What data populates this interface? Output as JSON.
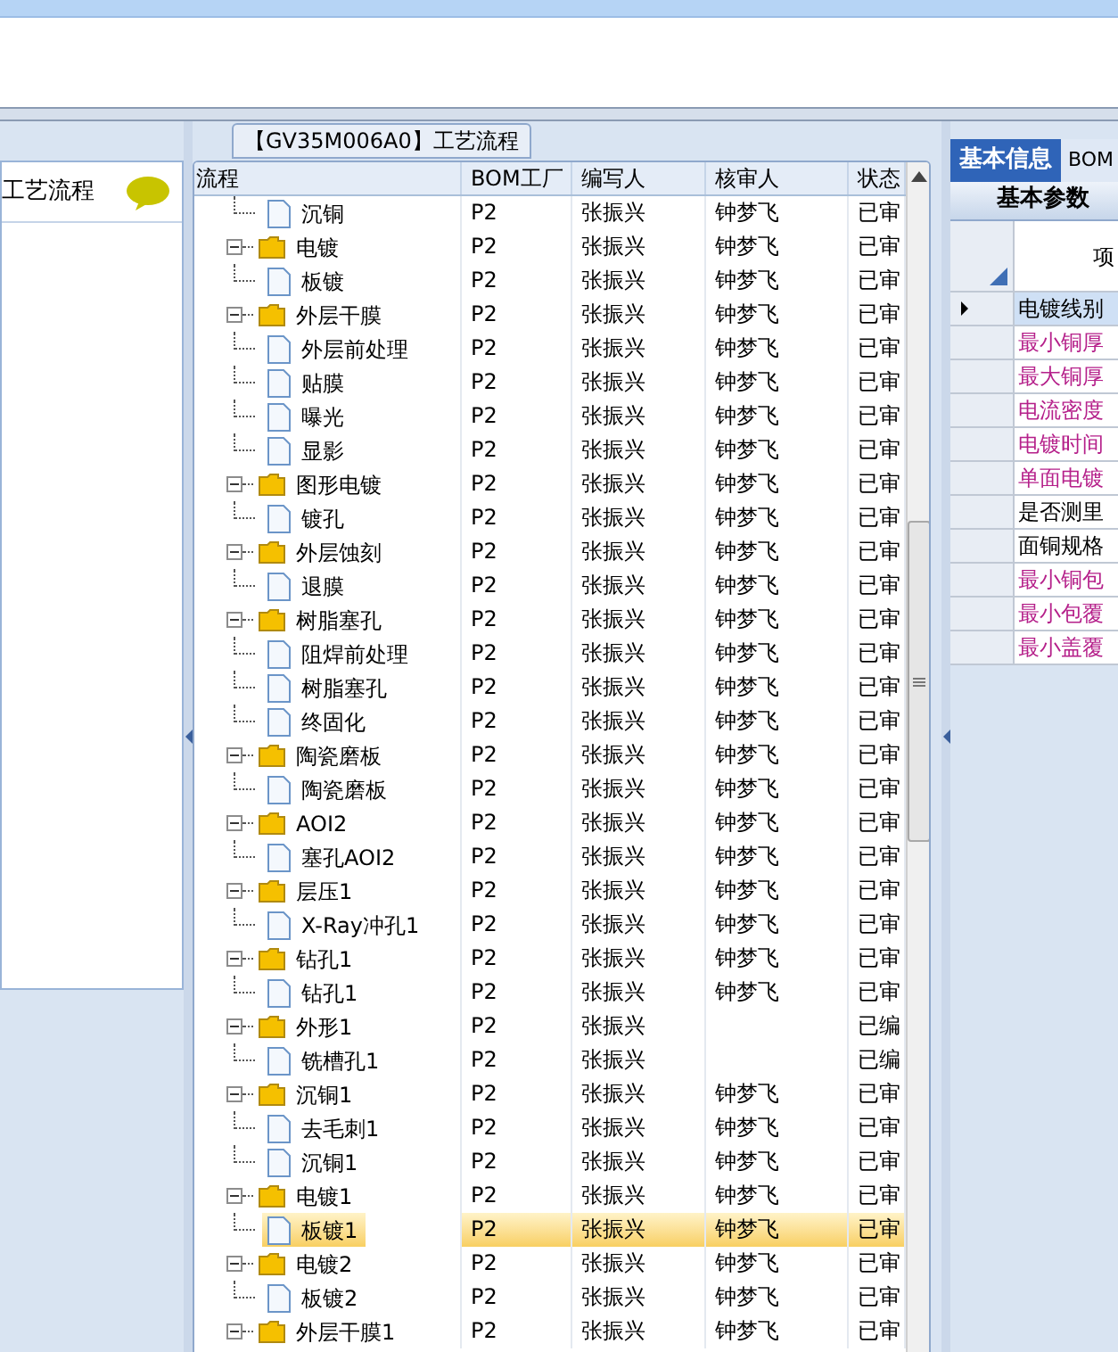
{
  "left_panel": {
    "title": "工艺流程"
  },
  "process_panel": {
    "title": "【GV35M006A0】工艺流程",
    "columns": [
      "流程",
      "BOM工厂",
      "编写人",
      "核审人",
      "状态"
    ],
    "tree": [
      {
        "label": "沉铜",
        "kind": "file",
        "bom": "P2",
        "writer": "张振兴",
        "reviewer": "钟梦飞",
        "status": "已审",
        "selected": false
      },
      {
        "label": "电镀",
        "kind": "folder",
        "expanded": true,
        "bom": "P2",
        "writer": "张振兴",
        "reviewer": "钟梦飞",
        "status": "已审",
        "selected": false,
        "children": [
          {
            "label": "板镀",
            "kind": "file",
            "bom": "P2",
            "writer": "张振兴",
            "reviewer": "钟梦飞",
            "status": "已审",
            "selected": false
          }
        ]
      },
      {
        "label": "外层干膜",
        "kind": "folder",
        "expanded": true,
        "bom": "P2",
        "writer": "张振兴",
        "reviewer": "钟梦飞",
        "status": "已审",
        "selected": false,
        "children": [
          {
            "label": "外层前处理",
            "kind": "file",
            "bom": "P2",
            "writer": "张振兴",
            "reviewer": "钟梦飞",
            "status": "已审",
            "selected": false
          },
          {
            "label": "贴膜",
            "kind": "file",
            "bom": "P2",
            "writer": "张振兴",
            "reviewer": "钟梦飞",
            "status": "已审",
            "selected": false
          },
          {
            "label": "曝光",
            "kind": "file",
            "bom": "P2",
            "writer": "张振兴",
            "reviewer": "钟梦飞",
            "status": "已审",
            "selected": false
          },
          {
            "label": "显影",
            "kind": "file",
            "bom": "P2",
            "writer": "张振兴",
            "reviewer": "钟梦飞",
            "status": "已审",
            "selected": false
          }
        ]
      },
      {
        "label": "图形电镀",
        "kind": "folder",
        "expanded": true,
        "bom": "P2",
        "writer": "张振兴",
        "reviewer": "钟梦飞",
        "status": "已审",
        "selected": false,
        "children": [
          {
            "label": "镀孔",
            "kind": "file",
            "bom": "P2",
            "writer": "张振兴",
            "reviewer": "钟梦飞",
            "status": "已审",
            "selected": false
          }
        ]
      },
      {
        "label": "外层蚀刻",
        "kind": "folder",
        "expanded": true,
        "bom": "P2",
        "writer": "张振兴",
        "reviewer": "钟梦飞",
        "status": "已审",
        "selected": false,
        "children": [
          {
            "label": "退膜",
            "kind": "file",
            "bom": "P2",
            "writer": "张振兴",
            "reviewer": "钟梦飞",
            "status": "已审",
            "selected": false
          }
        ]
      },
      {
        "label": "树脂塞孔",
        "kind": "folder",
        "expanded": true,
        "bom": "P2",
        "writer": "张振兴",
        "reviewer": "钟梦飞",
        "status": "已审",
        "selected": false,
        "children": [
          {
            "label": "阻焊前处理",
            "kind": "file",
            "bom": "P2",
            "writer": "张振兴",
            "reviewer": "钟梦飞",
            "status": "已审",
            "selected": false
          },
          {
            "label": "树脂塞孔",
            "kind": "file",
            "bom": "P2",
            "writer": "张振兴",
            "reviewer": "钟梦飞",
            "status": "已审",
            "selected": false
          },
          {
            "label": "终固化",
            "kind": "file",
            "bom": "P2",
            "writer": "张振兴",
            "reviewer": "钟梦飞",
            "status": "已审",
            "selected": false
          }
        ]
      },
      {
        "label": "陶瓷磨板",
        "kind": "folder",
        "expanded": true,
        "bom": "P2",
        "writer": "张振兴",
        "reviewer": "钟梦飞",
        "status": "已审",
        "selected": false,
        "children": [
          {
            "label": "陶瓷磨板",
            "kind": "file",
            "bom": "P2",
            "writer": "张振兴",
            "reviewer": "钟梦飞",
            "status": "已审",
            "selected": false
          }
        ]
      },
      {
        "label": "AOI2",
        "kind": "folder",
        "expanded": true,
        "bom": "P2",
        "writer": "张振兴",
        "reviewer": "钟梦飞",
        "status": "已审",
        "selected": false,
        "children": [
          {
            "label": "塞孔AOI2",
            "kind": "file",
            "bom": "P2",
            "writer": "张振兴",
            "reviewer": "钟梦飞",
            "status": "已审",
            "selected": false
          }
        ]
      },
      {
        "label": "层压1",
        "kind": "folder",
        "expanded": true,
        "bom": "P2",
        "writer": "张振兴",
        "reviewer": "钟梦飞",
        "status": "已审",
        "selected": false,
        "children": [
          {
            "label": "X-Ray冲孔1",
            "kind": "file",
            "bom": "P2",
            "writer": "张振兴",
            "reviewer": "钟梦飞",
            "status": "已审",
            "selected": false
          }
        ]
      },
      {
        "label": "钻孔1",
        "kind": "folder",
        "expanded": true,
        "bom": "P2",
        "writer": "张振兴",
        "reviewer": "钟梦飞",
        "status": "已审",
        "selected": false,
        "children": [
          {
            "label": "钻孔1",
            "kind": "file",
            "bom": "P2",
            "writer": "张振兴",
            "reviewer": "钟梦飞",
            "status": "已审",
            "selected": false
          }
        ]
      },
      {
        "label": "外形1",
        "kind": "folder",
        "expanded": true,
        "bom": "P2",
        "writer": "张振兴",
        "status": "已编",
        "selected": false,
        "children": [
          {
            "label": "铣槽孔1",
            "kind": "file",
            "bom": "P2",
            "writer": "张振兴",
            "status": "已编",
            "selected": false
          }
        ]
      },
      {
        "label": "沉铜1",
        "kind": "folder",
        "expanded": true,
        "bom": "P2",
        "writer": "张振兴",
        "reviewer": "钟梦飞",
        "status": "已审",
        "selected": false,
        "children": [
          {
            "label": "去毛刺1",
            "kind": "file",
            "bom": "P2",
            "writer": "张振兴",
            "reviewer": "钟梦飞",
            "status": "已审",
            "selected": false
          },
          {
            "label": "沉铜1",
            "kind": "file",
            "bom": "P2",
            "writer": "张振兴",
            "reviewer": "钟梦飞",
            "status": "已审",
            "selected": false
          }
        ]
      },
      {
        "label": "电镀1",
        "kind": "folder",
        "expanded": true,
        "bom": "P2",
        "writer": "张振兴",
        "reviewer": "钟梦飞",
        "status": "已审",
        "selected": false,
        "children": [
          {
            "label": "板镀1",
            "kind": "file",
            "bom": "P2",
            "writer": "张振兴",
            "reviewer": "钟梦飞",
            "status": "已审",
            "selected": true
          }
        ]
      },
      {
        "label": "电镀2",
        "kind": "folder",
        "expanded": true,
        "bom": "P2",
        "writer": "张振兴",
        "reviewer": "钟梦飞",
        "status": "已审",
        "selected": false,
        "children": [
          {
            "label": "板镀2",
            "kind": "file",
            "bom": "P2",
            "writer": "张振兴",
            "reviewer": "钟梦飞",
            "status": "已审",
            "selected": false
          }
        ]
      },
      {
        "label": "外层干膜1",
        "kind": "folder",
        "expanded": true,
        "bom": "P2",
        "writer": "张振兴",
        "reviewer": "钟梦飞",
        "status": "已审",
        "selected": false
      }
    ]
  },
  "right_panel": {
    "tabs": [
      {
        "label": "基本信息",
        "selected": true
      },
      {
        "label": "BOM",
        "selected": false
      }
    ],
    "subtab": "基本参数",
    "column": "项",
    "rows": [
      {
        "label": "电镀线别",
        "color": "#000000",
        "selected": true
      },
      {
        "label": "最小铜厚",
        "color": "#b5208a",
        "selected": false
      },
      {
        "label": "最大铜厚",
        "color": "#b5208a",
        "selected": false
      },
      {
        "label": "电流密度",
        "color": "#b5208a",
        "selected": false
      },
      {
        "label": "电镀时间",
        "color": "#b5208a",
        "selected": false
      },
      {
        "label": "单面电镀",
        "color": "#b5208a",
        "selected": false
      },
      {
        "label": "是否测里",
        "color": "#000000",
        "selected": false
      },
      {
        "label": "面铜规格",
        "color": "#000000",
        "selected": false
      },
      {
        "label": "最小铜包",
        "color": "#b5208a",
        "selected": false
      },
      {
        "label": "最小包覆",
        "color": "#b5208a",
        "selected": false
      },
      {
        "label": "最小盖覆",
        "color": "#b5208a",
        "selected": false
      }
    ]
  }
}
